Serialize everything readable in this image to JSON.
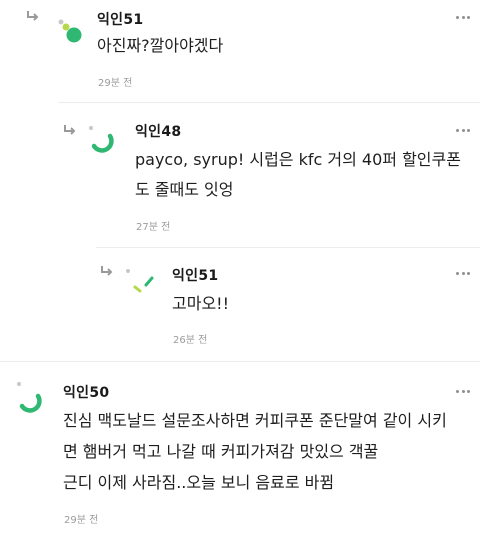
{
  "comments": [
    {
      "author": "익인51",
      "lines": [
        "아진짜?깔아야겠다"
      ],
      "time": "29분 전",
      "avatar_icon": "dot-cluster-avatar-icon"
    },
    {
      "author": "익인48",
      "lines": [
        "payco, syrup! 시럽은 kfc 거의 40퍼 할인쿠폰",
        "도 줄때도 잇엉"
      ],
      "time": "27분 전",
      "avatar_icon": "green-arc-avatar-icon"
    },
    {
      "author": "익인51",
      "lines": [
        "고마오!!"
      ],
      "time": "26분 전",
      "avatar_icon": "green-dashes-avatar-icon"
    },
    {
      "author": "익인50",
      "lines": [
        "진심 맥도날드 설문조사하면 커피쿠폰 준단말여 같이 시키",
        "면 햄버거 먹고 나갈 때 커피가져감 맛있으 객꿀",
        "근디 이제 사라짐..오늘 보니 음료로 바뀜"
      ],
      "time": "29분 전",
      "avatar_icon": "green-arc-avatar-icon"
    }
  ],
  "colors": {
    "accent_green": "#2eb872",
    "accent_light_green": "#b6d94c",
    "avatar_gray": "#c8c8c8",
    "icon_gray": "#9a9a9a"
  }
}
